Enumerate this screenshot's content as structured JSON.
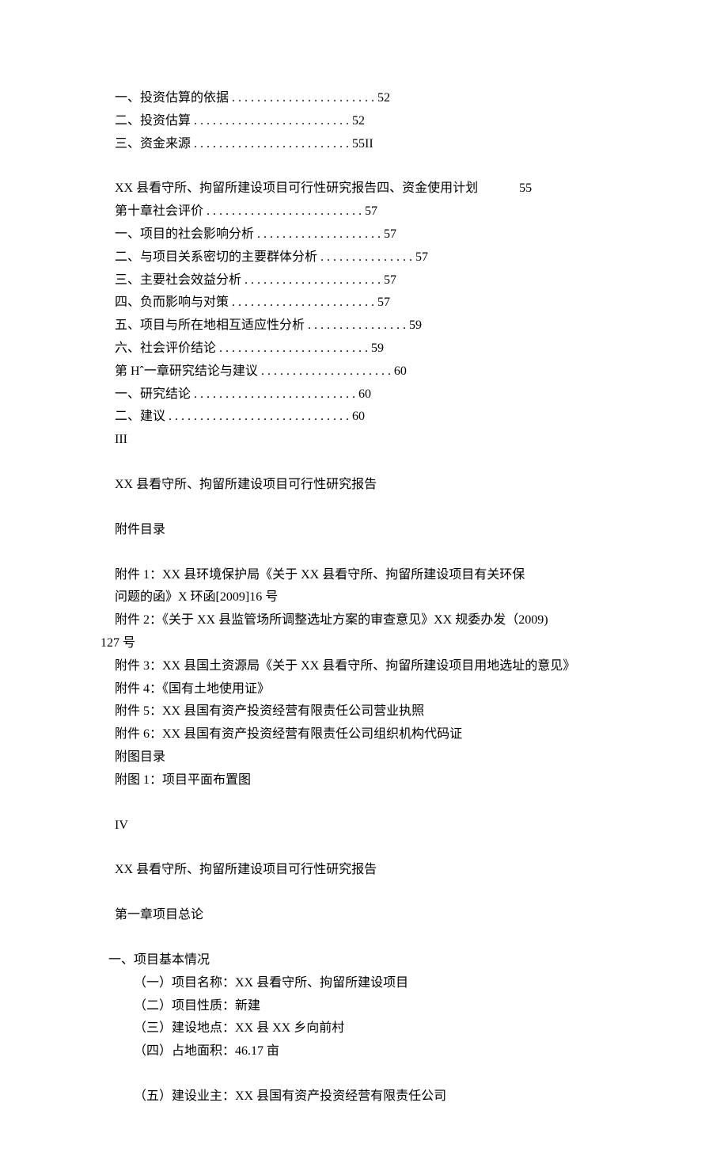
{
  "toc1": [
    {
      "label": "一、投资估算的依据",
      "dots": " . . . . . . . . . . . . . . . . . . . . . . . ",
      "page": "52"
    },
    {
      "label": "二、投资估算",
      "dots": "  . . . . . . . . . . . . . . . . . . . . . . . . . ",
      "page": "52"
    },
    {
      "label": "三、资金来源",
      "dots": "  . . . . . . . . . . . . . . . . . . . . . . . . . ",
      "page": "55II"
    }
  ],
  "line_special": {
    "prefix": "XX 县看守所、拘留所建设项目可行性研究报告四、资金使用计划",
    "num": "55"
  },
  "toc2": [
    {
      "label": "第十章社会评价",
      "dots": " . . . . . . . . . . . . . . . . . . . . . . . . . ",
      "page": "57"
    },
    {
      "label": "一、项目的社会影响分析",
      "dots": " . . . . . . . . . . . . . . . . . . . . ",
      "page": "57"
    },
    {
      "label": "二、与项目关系密切的主要群体分析",
      "dots": " . . . . . . . . . . . . . . . ",
      "page": "57"
    },
    {
      "label": "三、主要社会效益分析",
      "dots": "  . . . . . . . . . . . . . . . . . . . . . . ",
      "page": "57"
    },
    {
      "label": "四、负而影响与对策 ",
      "dots": " . . . . . . . . . . . . . . . . . . . . . . . ",
      "page": "57"
    },
    {
      "label": "五、项目与所在地相互适应性分析 ",
      "dots": " . . . . . . . . . . . . . . . . ",
      "page": "59"
    },
    {
      "label": "六、社会评价结论",
      "dots": " . . . . . . . . . . . . . . . . . . . . . . . . ",
      "page": "59"
    },
    {
      "label": "第 Hˆ一章研究结论与建议",
      "dots": "  . . . . . . . . . . . . . . . . . . . . . ",
      "page": "60"
    },
    {
      "label": "一、研究结论",
      "dots": " . . . . . . . . . . . . . . . . . . . . . . . . . . ",
      "page": "60"
    },
    {
      "label": "二、建议",
      "dots": " . . . . . . . . . . . . . . . . . . . . . . . . . . . . . ",
      "page": "60"
    }
  ],
  "roman_iii": "III",
  "heading_repeat": "XX 县看守所、拘留所建设项目可行性研究报告",
  "attach_heading": "附件目录",
  "attachments": [
    "附件 1：XX 县环境保护局《关于 XX 县看守所、拘留所建设项目有关环保",
    "问题的函》X 环函[2009]16 号",
    "附件 2：《关于 XX 县监管场所调整选址方案的审查意见》XX 规委办发（2009)"
  ],
  "attachments_127": "127 号",
  "attachments2": [
    "附件 3：XX 县国土资源局《关于 XX 县看守所、拘留所建设项目用地选址的意见》",
    "附件 4：《国有土地使用证》",
    "附件 5：XX 县国有资产投资经营有限责任公司营业执照",
    "附件 6：XX 县国有资产投资经营有限责任公司组织机构代码证",
    "附图目录",
    "附图 1：项目平面布置图"
  ],
  "roman_iv": "IV",
  "chapter1_heading": "第一章项目总论",
  "section1_heading": "一、项目基本情况",
  "basics": [
    "（一）项目名称：XX 县看守所、拘留所建设项目",
    "（二）项目性质：新建",
    "（三）建设地点：XX 县 XX 乡向前村",
    "（四）占地面积：46.17 亩"
  ],
  "basics_last": "（五）建设业主：XX 县国有资产投资经营有限责任公司"
}
